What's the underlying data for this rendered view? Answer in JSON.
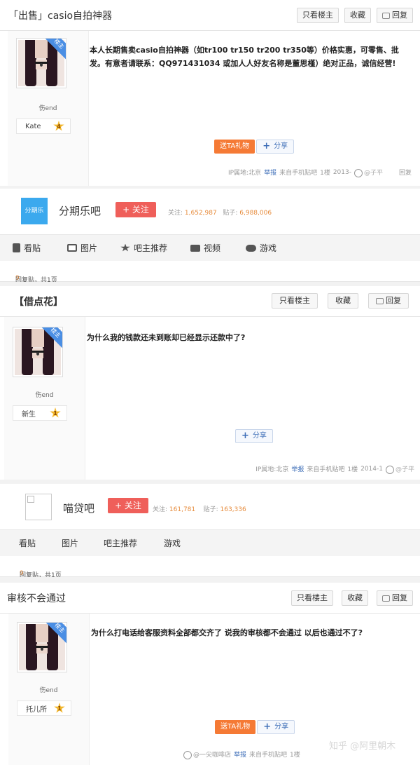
{
  "post1": {
    "title": "「出售」casio自拍神器",
    "buttons": {
      "only_author": "只看楼主",
      "collect": "收藏",
      "reply": "回复"
    },
    "owner_tag": "楼主",
    "author": {
      "name": "伤end",
      "level_name": "Kate",
      "level": "4"
    },
    "content": "本人长期售卖casio自拍神器（如tr100 tr150 tr200 tr350等）价格实惠，可零售、批发。有意者请联系：QQ971431034 或加人人好友名称是董思槿）绝对正品，诚信经营!",
    "gift": "送TA礼物",
    "share": "分享",
    "meta": {
      "ip": "IP属地:北京",
      "report": "举报",
      "source": "来自手机贴吧",
      "floor": "1楼",
      "date": "2013-",
      "reply": "回复"
    }
  },
  "bar1": {
    "logo_text": "分期乐",
    "name": "分期乐吧",
    "follow": "+ 关注",
    "stats": {
      "follow_label": "关注:",
      "follow_num": "1,652,987",
      "posts_label": "贴子:",
      "posts_num": "6,988,006"
    },
    "nav": [
      "看贴",
      "图片",
      "吧主推荐",
      "视频",
      "游戏"
    ],
    "count": {
      "num": "9",
      "text": "回复贴，共1页"
    }
  },
  "post2": {
    "title": "【借点花】",
    "buttons": {
      "only_author": "只看楼主",
      "collect": "收藏",
      "reply": "回复"
    },
    "owner_tag": "楼主",
    "author": {
      "name": "伤end",
      "level_name": "新生",
      "level": "1"
    },
    "content": "为什么我的钱款还未到账却已经显示还款中了?",
    "share": "分享",
    "meta": {
      "ip": "IP属地:北京",
      "report": "举报",
      "source": "来自手机贴吧",
      "floor": "1楼",
      "date": "2014-1"
    }
  },
  "bar2": {
    "name": "喵贷吧",
    "follow": "+ 关注",
    "stats": {
      "follow_label": "关注:",
      "follow_num": "161,781",
      "posts_label": "贴子:",
      "posts_num": "163,336"
    },
    "nav": [
      "看贴",
      "图片",
      "吧主推荐",
      "游戏"
    ],
    "count": {
      "num": "9",
      "text": "回复贴，共1页"
    }
  },
  "post3": {
    "title": "审核不会通过",
    "buttons": {
      "only_author": "只看楼主",
      "collect": "收藏",
      "reply": "回复"
    },
    "owner_tag": "楼主",
    "author": {
      "name": "伤end",
      "level_name": "托儿所",
      "level": "1"
    },
    "content": "为什么打电话给客服资料全部都交齐了 说我的审核都不会通过 以后也通过不了?",
    "gift": "送TA礼物",
    "share": "分享",
    "meta": {
      "report": "举报",
      "source": "来自手机贴吧",
      "floor": "1楼"
    }
  },
  "watermarks": {
    "w1": "@子平",
    "w2": "@子平",
    "w3": "知乎 @阿里朝木",
    "w4": "@一尖咖啡店"
  }
}
